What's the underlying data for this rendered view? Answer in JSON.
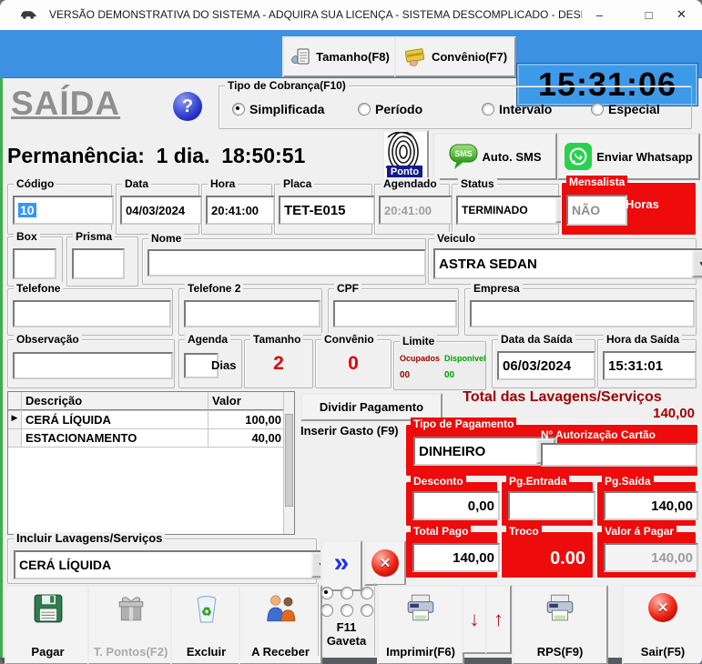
{
  "titlebar": {
    "title": "VERSÃO DEMONSTRATIVA DO SISTEMA - ADQUIRA SUA LICENÇA - SISTEMA DESCOMPLICADO - DESENVOLVI...",
    "minimize": "–",
    "maximize": "□",
    "close": "✕"
  },
  "toolbar": {
    "tamanho": "Tamanho(F8)",
    "convenio": "Convênio(F7)",
    "clock": "15:31:06"
  },
  "header": {
    "page_title": "SAÍDA",
    "help": "?",
    "cobranca": {
      "legend": "Tipo de Cobrança(F10)",
      "options": [
        "Simplificada",
        "Período",
        "Intervalo",
        "Especial"
      ],
      "selected": "Simplificada"
    },
    "permanencia": "Permanência:  1 dia.  18:50:51",
    "ponto": "Ponto",
    "sms_badge": "SMS",
    "sms": "Auto. SMS",
    "whatsapp": "Enviar Whatsapp"
  },
  "fields": {
    "codigo": {
      "label": "Código",
      "value": "10"
    },
    "data": {
      "label": "Data",
      "value": "04/03/2024"
    },
    "hora": {
      "label": "Hora",
      "value": "20:41:00"
    },
    "placa": {
      "label": "Placa",
      "value": "TET-E015"
    },
    "agendado": {
      "label": "Agendado",
      "value": "20:41:00"
    },
    "status": {
      "label": "Status",
      "value": "TERMINADO"
    },
    "mensalista": {
      "legend": "Mensalista",
      "value": "NÃO",
      "horas": "Horas"
    },
    "box": {
      "label": "Box",
      "value": ""
    },
    "prisma": {
      "label": "Prisma",
      "value": ""
    },
    "nome": {
      "label": "Nome",
      "value": ""
    },
    "veiculo": {
      "label": "Veiculo",
      "value": "ASTRA SEDAN"
    },
    "telefone": {
      "label": "Telefone",
      "value": ""
    },
    "telefone2": {
      "label": "Telefone 2",
      "value": ""
    },
    "cpf": {
      "label": "CPF",
      "value": ""
    },
    "empresa": {
      "label": "Empresa",
      "value": ""
    },
    "observacao": {
      "label": "Observação",
      "value": ""
    },
    "agenda": {
      "label": "Agenda",
      "value": "",
      "suffix": "Dias"
    },
    "tamanho": {
      "label": "Tamanho",
      "value": "2"
    },
    "convenio": {
      "label": "Convênio",
      "value": "0"
    },
    "limite": {
      "legend": "Limite",
      "ocupados_label": "Ocupados",
      "ocupados": "00",
      "disponivel_label": "Disponivel",
      "disponivel": "00"
    },
    "data_saida": {
      "label": "Data da Saída",
      "value": "06/03/2024"
    },
    "hora_saida": {
      "label": "Hora da Saída",
      "value": "15:31:01"
    }
  },
  "servicos_table": {
    "columns": [
      "Descrição",
      "Valor"
    ],
    "rows": [
      {
        "descricao": "CERÁ LÍQUIDA",
        "valor": "100,00"
      },
      {
        "descricao": "ESTACIONAMENTO",
        "valor": "40,00"
      }
    ]
  },
  "pagamento": {
    "dividir": "Dividir Pagamento",
    "total_lavagens_label": "Total das Lavagens/Serviços",
    "total_lavagens": "140,00",
    "inserir_gasto": "Inserir Gasto (F9)",
    "tipo_legend": "Tipo de Pagamento",
    "tipo_value": "DINHEIRO",
    "autorizacao_label": "Nº Autorização Cartão",
    "autorizacao_value": "",
    "desconto": {
      "legend": "Desconto",
      "value": "0,00"
    },
    "pg_entrada": {
      "legend": "Pg.Entrada",
      "value": ""
    },
    "pg_saida": {
      "legend": "Pg.Saída",
      "value": "140,00"
    },
    "total_pago": {
      "legend": "Total Pago",
      "value": "140,00"
    },
    "troco": {
      "legend": "Troco",
      "value": "0.00"
    },
    "valor_pagar": {
      "legend": "Valor á Pagar",
      "value": "140,00"
    }
  },
  "incluir": {
    "legend": "Incluir Lavagens/Serviços",
    "value": "CERÁ LÍQUIDA",
    "add": "»"
  },
  "actions": {
    "pagar": "Pagar",
    "tpontos": "T. Pontos(F2)",
    "excluir": "Excluir",
    "areceber": "A Receber",
    "gaveta_line1": "F11",
    "gaveta_line2": "Gaveta",
    "imprimir": "Imprimir(F6)",
    "down": "↓",
    "up": "↑",
    "rps": "RPS(F9)",
    "sair": "Sair(F5)"
  },
  "colors": {
    "toolbar_blue": "#3c91e2",
    "clock_blue": "#3d9ae8",
    "panel_red": "#ee0b0b",
    "dark_red_text": "#a00000",
    "green_ok": "#00a000"
  }
}
